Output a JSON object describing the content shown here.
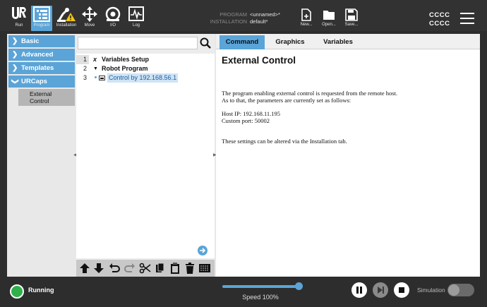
{
  "topbar": {
    "nav": [
      {
        "label": "Run",
        "icon": "ur-logo-icon"
      },
      {
        "label": "Program",
        "icon": "program-icon"
      },
      {
        "label": "Installation",
        "icon": "installation-icon"
      },
      {
        "label": "Move",
        "icon": "move-icon"
      },
      {
        "label": "I/O",
        "icon": "io-icon"
      },
      {
        "label": "Log",
        "icon": "log-icon"
      }
    ],
    "program_key": "PROGRAM",
    "program_value": "<unnamed>*",
    "installation_key": "INSTALLATION",
    "installation_value": "default*",
    "file_buttons": [
      {
        "label": "New...",
        "icon": "new-file-icon"
      },
      {
        "label": "Open...",
        "icon": "open-folder-icon"
      },
      {
        "label": "Save...",
        "icon": "save-icon"
      }
    ],
    "robot_name_line1": "CCCC",
    "robot_name_line2": "CCCC"
  },
  "sidebar": {
    "categories": [
      {
        "label": "Basic",
        "chevron": ">"
      },
      {
        "label": "Advanced",
        "chevron": ">"
      },
      {
        "label": "Templates",
        "chevron": ">"
      },
      {
        "label": "URCaps",
        "chevron": "v"
      }
    ],
    "subitem_line1": "External",
    "subitem_line2": "Control"
  },
  "tree": {
    "search_placeholder": "",
    "rows": [
      {
        "num": "1",
        "icon": "x",
        "label": "Variables Setup"
      },
      {
        "num": "2",
        "icon": "▼",
        "label": "Robot Program"
      },
      {
        "num": "3",
        "icon": "",
        "label": "Control by 192.168.56.1"
      }
    ]
  },
  "right": {
    "tabs": [
      "Command",
      "Graphics",
      "Variables"
    ],
    "active_tab": "Command",
    "title": "External Control",
    "para1_line1": "The program enabling external control is requested from the remote host.",
    "para1_line2": "As to that, the parameters are currently set as follows:",
    "host_ip": "Host IP: 192.168.11.195",
    "custom_port": "Custom port: 50002",
    "para3": "These settings can be altered via the Installation tab."
  },
  "bottombar": {
    "status": "Running",
    "speed_label": "Speed 100%",
    "speed_fraction": 1.0,
    "simulation_label": "Simulation",
    "simulation_on": false
  },
  "colors": {
    "accent": "#5aa4d8",
    "running": "#2fb04a",
    "topbar": "#323232"
  }
}
